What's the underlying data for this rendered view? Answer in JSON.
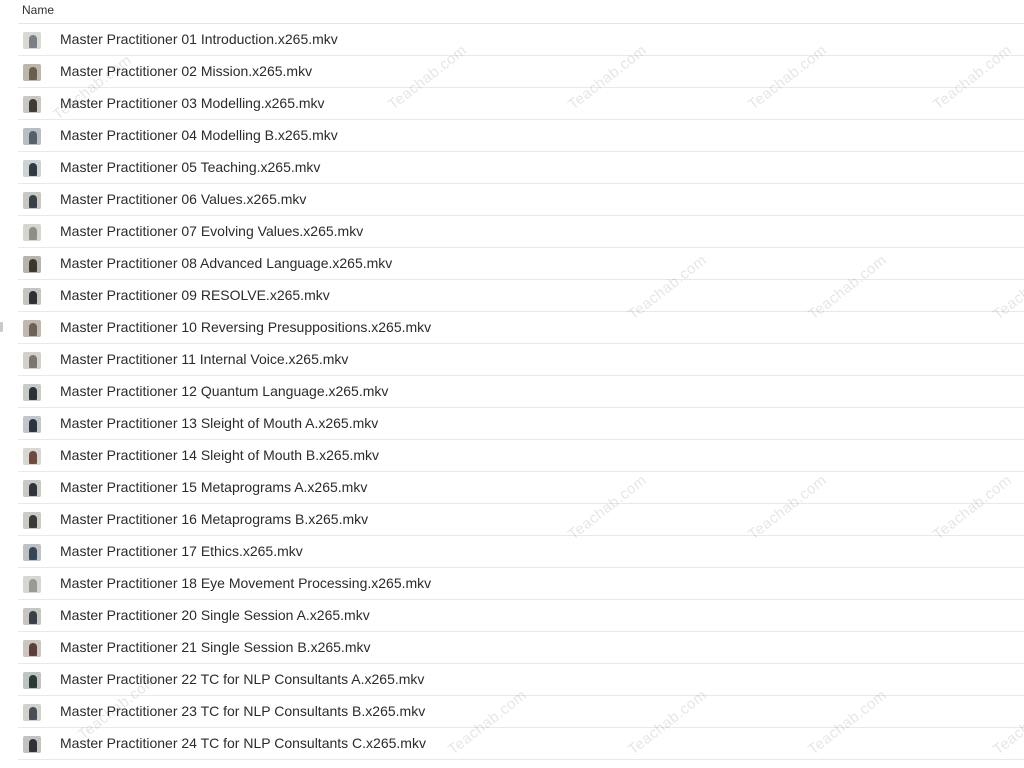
{
  "header": {
    "name_label": "Name"
  },
  "files": [
    {
      "name": "Master Practitioner 01 Introduction.x265.mkv",
      "thumb_bg": "#d9d9d4",
      "thumb_fg": "#7a7f86"
    },
    {
      "name": "Master Practitioner 02 Mission.x265.mkv",
      "thumb_bg": "#bdb7a9",
      "thumb_fg": "#6a5f4f"
    },
    {
      "name": "Master Practitioner 03 Modelling.x265.mkv",
      "thumb_bg": "#c9c7c1",
      "thumb_fg": "#3e3a36"
    },
    {
      "name": "Master Practitioner 04 Modelling B.x265.mkv",
      "thumb_bg": "#b9bec4",
      "thumb_fg": "#56606a"
    },
    {
      "name": "Master Practitioner 05 Teaching.x265.mkv",
      "thumb_bg": "#cfd2d3",
      "thumb_fg": "#2f3a45"
    },
    {
      "name": "Master Practitioner 06 Values.x265.mkv",
      "thumb_bg": "#c7c8c2",
      "thumb_fg": "#36414a"
    },
    {
      "name": "Master Practitioner 07 Evolving Values.x265.mkv",
      "thumb_bg": "#d6d6cf",
      "thumb_fg": "#8e9088"
    },
    {
      "name": "Master Practitioner 08 Advanced Language.x265.mkv",
      "thumb_bg": "#b7b4ac",
      "thumb_fg": "#3b3630"
    },
    {
      "name": "Master Practitioner 09 RESOLVE.x265.mkv",
      "thumb_bg": "#c5c5bf",
      "thumb_fg": "#2f2f35"
    },
    {
      "name": "Master Practitioner 10 Reversing Presuppositions.x265.mkv",
      "thumb_bg": "#c0b8ad",
      "thumb_fg": "#6d6257"
    },
    {
      "name": "Master Practitioner 11 Internal Voice.x265.mkv",
      "thumb_bg": "#d3d1cc",
      "thumb_fg": "#7c766f"
    },
    {
      "name": "Master Practitioner 12 Quantum Language.x265.mkv",
      "thumb_bg": "#c9cbc7",
      "thumb_fg": "#2d3238"
    },
    {
      "name": "Master Practitioner 13 Sleight of Mouth A.x265.mkv",
      "thumb_bg": "#c3c6c9",
      "thumb_fg": "#2a3440"
    },
    {
      "name": "Master Practitioner 14 Sleight of Mouth B.x265.mkv",
      "thumb_bg": "#d8d7d2",
      "thumb_fg": "#6f4a3f"
    },
    {
      "name": "Master Practitioner 15 Metaprograms A.x265.mkv",
      "thumb_bg": "#c8c8c4",
      "thumb_fg": "#2f343c"
    },
    {
      "name": "Master Practitioner 16 Metaprograms B.x265.mkv",
      "thumb_bg": "#cbcac4",
      "thumb_fg": "#3a3a3a"
    },
    {
      "name": "Master Practitioner 17 Ethics.x265.mkv",
      "thumb_bg": "#bfc2c4",
      "thumb_fg": "#364654"
    },
    {
      "name": "Master Practitioner 18 Eye Movement Processing.x265.mkv",
      "thumb_bg": "#d6d6d2",
      "thumb_fg": "#9a9a94"
    },
    {
      "name": "Master Practitioner 20 Single Session A.x265.mkv",
      "thumb_bg": "#c6c5c0",
      "thumb_fg": "#3a4048"
    },
    {
      "name": "Master Practitioner 21 Single Session B.x265.mkv",
      "thumb_bg": "#cbc6c0",
      "thumb_fg": "#5c3f3a"
    },
    {
      "name": "Master Practitioner 22 TC for NLP Consultants A.x265.mkv",
      "thumb_bg": "#bfc4c1",
      "thumb_fg": "#2b3b3a"
    },
    {
      "name": "Master Practitioner 23 TC for NLP Consultants B.x265.mkv",
      "thumb_bg": "#d2d2cc",
      "thumb_fg": "#4a4f56"
    },
    {
      "name": "Master Practitioner 24 TC for NLP Consultants C.x265.mkv",
      "thumb_bg": "#c2c3c0",
      "thumb_fg": "#2e3138"
    }
  ],
  "watermark": {
    "text": "Teachab.com"
  }
}
